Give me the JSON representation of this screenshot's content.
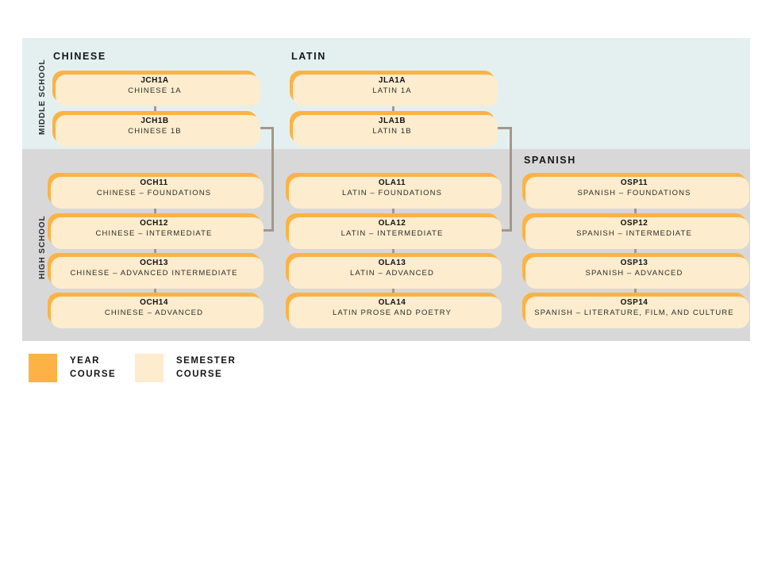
{
  "bands": {
    "middle": {
      "label": "MIDDLE SCHOOL",
      "color": "#e4f0f0"
    },
    "high": {
      "label": "HIGH SCHOOL",
      "color": "#d8d8d8"
    }
  },
  "columns": [
    {
      "key": "chinese",
      "heading": "CHINESE"
    },
    {
      "key": "latin",
      "heading": "LATIN"
    },
    {
      "key": "spanish",
      "heading": "SPANISH"
    }
  ],
  "courses": {
    "chinese_middle": [
      {
        "code": "JCH1A",
        "title": "CHINESE 1A"
      },
      {
        "code": "JCH1B",
        "title": "CHINESE 1B"
      }
    ],
    "latin_middle": [
      {
        "code": "JLA1A",
        "title": "LATIN 1A"
      },
      {
        "code": "JLA1B",
        "title": "LATIN 1B"
      }
    ],
    "chinese_high": [
      {
        "code": "OCH11",
        "title": "CHINESE – FOUNDATIONS"
      },
      {
        "code": "OCH12",
        "title": "CHINESE – INTERMEDIATE"
      },
      {
        "code": "OCH13",
        "title": "CHINESE – ADVANCED INTERMEDIATE"
      },
      {
        "code": "OCH14",
        "title": "CHINESE – ADVANCED"
      }
    ],
    "latin_high": [
      {
        "code": "OLA11",
        "title": "LATIN – FOUNDATIONS"
      },
      {
        "code": "OLA12",
        "title": "LATIN – INTERMEDIATE"
      },
      {
        "code": "OLA13",
        "title": "LATIN – ADVANCED"
      },
      {
        "code": "OLA14",
        "title": "LATIN PROSE AND POETRY"
      }
    ],
    "spanish_high": [
      {
        "code": "OSP11",
        "title": "SPANISH – FOUNDATIONS"
      },
      {
        "code": "OSP12",
        "title": "SPANISH – INTERMEDIATE"
      },
      {
        "code": "OSP13",
        "title": "SPANISH – ADVANCED"
      },
      {
        "code": "OSP14",
        "title": "SPANISH – LITERATURE, FILM, AND CULTURE"
      }
    ]
  },
  "legend": {
    "year": {
      "line1": "YEAR",
      "line2": "COURSE",
      "color": "#fcb245"
    },
    "semester": {
      "line1": "SEMESTER",
      "line2": "COURSE",
      "color": "#fdeccd"
    }
  },
  "colors": {
    "course_fill": "#fcb245",
    "course_shadow": "#fdeccd",
    "connector": "#a4978a",
    "middle_band": "#e4f0f0",
    "high_band": "#d8d8d8",
    "text": "#141414"
  }
}
